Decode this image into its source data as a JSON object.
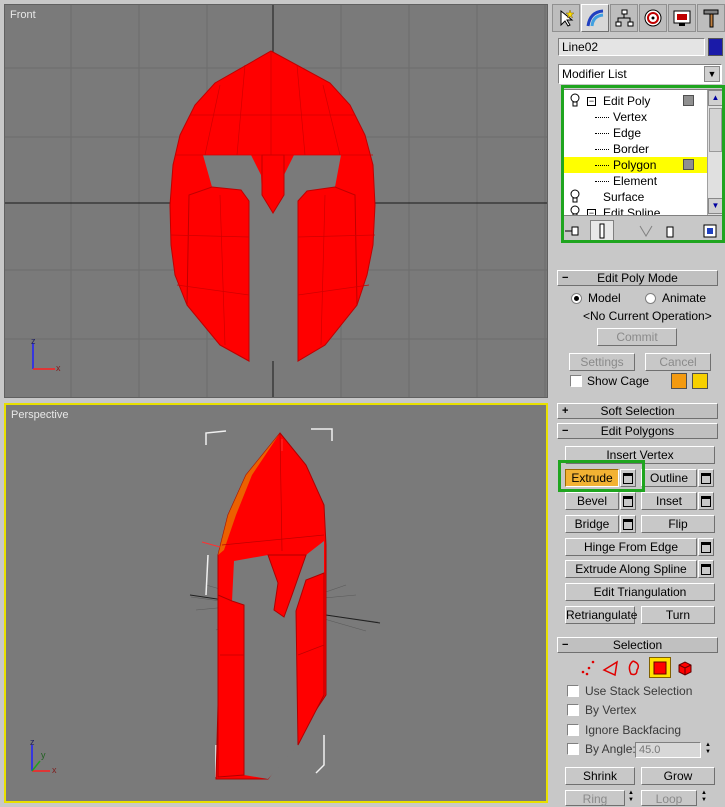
{
  "viewports": {
    "front_label": "Front",
    "perspective_label": "Perspective",
    "axis_z": "z",
    "axis_x": "x",
    "axis_y": "y"
  },
  "panel": {
    "tabs": [
      {
        "name": "create-tab",
        "icon": "cursor-star-icon"
      },
      {
        "name": "modify-tab",
        "icon": "rainbow-arc-icon"
      },
      {
        "name": "hierarchy-tab",
        "icon": "hierarchy-icon"
      },
      {
        "name": "motion-tab",
        "icon": "motion-disc-icon"
      },
      {
        "name": "display-tab",
        "icon": "monitor-icon"
      },
      {
        "name": "utilities-tab",
        "icon": "hammer-icon"
      }
    ],
    "object_name": "Line02",
    "object_color": "#1a1aa8",
    "modifier_list": "Modifier List",
    "stack": [
      {
        "label": "Edit Poly",
        "level": 0
      },
      {
        "label": "Vertex",
        "level": 1
      },
      {
        "label": "Edge",
        "level": 1
      },
      {
        "label": "Border",
        "level": 1
      },
      {
        "label": "Polygon",
        "level": 1,
        "selected": true
      },
      {
        "label": "Element",
        "level": 1
      },
      {
        "label": "Surface",
        "level": 0
      },
      {
        "label": "Edit Spline",
        "level": 0
      }
    ]
  },
  "edit_poly_mode": {
    "title": "Edit Poly Mode",
    "model": "Model",
    "animate": "Animate",
    "status": "<No Current Operation>",
    "commit": "Commit",
    "settings": "Settings",
    "cancel": "Cancel",
    "show_cage": "Show Cage",
    "cage_color_1": "#f39a10",
    "cage_color_2": "#f7d000"
  },
  "soft_selection": {
    "sign": "+",
    "title": "Soft Selection"
  },
  "edit_polygons": {
    "sign": "-",
    "title": "Edit Polygons",
    "insert_vertex": "Insert Vertex",
    "extrude": "Extrude",
    "outline": "Outline",
    "bevel": "Bevel",
    "inset": "Inset",
    "bridge": "Bridge",
    "flip": "Flip",
    "hinge_from_edge": "Hinge From Edge",
    "extrude_along_spline": "Extrude Along Spline",
    "edit_triangulation": "Edit Triangulation",
    "retriangulate": "Retriangulate",
    "turn": "Turn"
  },
  "selection": {
    "sign": "-",
    "title": "Selection",
    "use_stack_selection": "Use Stack Selection",
    "by_vertex": "By Vertex",
    "ignore_backfacing": "Ignore Backfacing",
    "by_angle": "By Angle:",
    "angle_value": "45.0",
    "shrink": "Shrink",
    "grow": "Grow",
    "ring": "Ring",
    "loop": "Loop"
  },
  "colors": {
    "highlight_green": "#1fa51f",
    "mesh_red": "#ff0000",
    "active_viewport_border": "#e8e000",
    "selected_item": "#ffff00",
    "active_button": "#f2b233"
  }
}
